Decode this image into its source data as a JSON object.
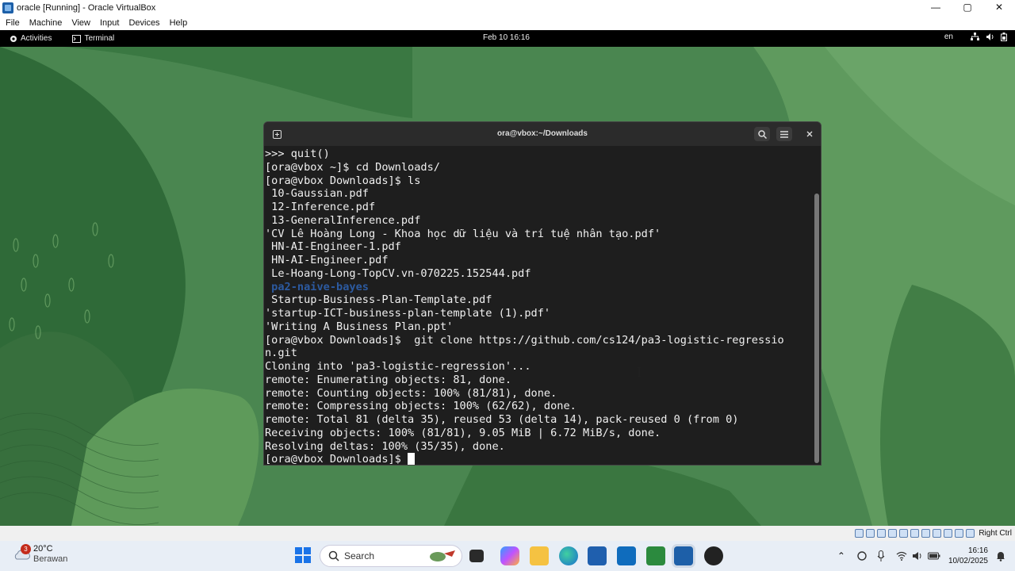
{
  "host_window": {
    "title": "oracle [Running] - Oracle VirtualBox",
    "controls": {
      "minimize": "—",
      "maximize": "▢",
      "close": "✕"
    },
    "menu": [
      "File",
      "Machine",
      "View",
      "Input",
      "Devices",
      "Help"
    ]
  },
  "gnome_bar": {
    "activities": "Activities",
    "app_label": "Terminal",
    "clock": "Feb 10  16:16",
    "lang": "en"
  },
  "terminal": {
    "title": "ora@vbox:~/Downloads",
    "lines": [
      {
        "text": ">>> quit()"
      },
      {
        "text": "[ora@vbox ~]$ cd Downloads/"
      },
      {
        "text": "[ora@vbox Downloads]$ ls"
      },
      {
        "text": " 10-Gaussian.pdf"
      },
      {
        "text": " 12-Inference.pdf"
      },
      {
        "text": " 13-GeneralInference.pdf"
      },
      {
        "text": "'CV Lê Hoàng Long - Khoa học dữ liệu và trí tuệ nhân tạo.pdf'"
      },
      {
        "text": " HN-AI-Engineer-1.pdf"
      },
      {
        "text": " HN-AI-Engineer.pdf"
      },
      {
        "text": " Le-Hoang-Long-TopCV.vn-070225.152544.pdf"
      },
      {
        "text": " pa2-naive-bayes",
        "dir": true
      },
      {
        "text": " Startup-Business-Plan-Template.pdf"
      },
      {
        "text": "'startup-ICT-business-plan-template (1).pdf'"
      },
      {
        "text": "'Writing A Business Plan.ppt'"
      },
      {
        "text": "[ora@vbox Downloads]$  git clone https://github.com/cs124/pa3-logistic-regressio"
      },
      {
        "text": "n.git"
      },
      {
        "text": "Cloning into 'pa3-logistic-regression'..."
      },
      {
        "text": "remote: Enumerating objects: 81, done."
      },
      {
        "text": "remote: Counting objects: 100% (81/81), done."
      },
      {
        "text": "remote: Compressing objects: 100% (62/62), done."
      },
      {
        "text": "remote: Total 81 (delta 35), reused 53 (delta 14), pack-reused 0 (from 0)"
      },
      {
        "text": "Receiving objects: 100% (81/81), 9.05 MiB | 6.72 MiB/s, done."
      },
      {
        "text": "Resolving deltas: 100% (35/35), done."
      }
    ],
    "prompt": "[ora@vbox Downloads]$ "
  },
  "host_status": {
    "right_ctrl": "Right Ctrl"
  },
  "taskbar": {
    "weather_temp": "20°C",
    "weather_desc": "Berawan",
    "notification_count": "3",
    "search_placeholder": "Search",
    "time": "16:16",
    "date": "10/02/2025"
  },
  "colors": {
    "dir_blue": "#2c5aa0",
    "terminal_bg": "#1e1e1e",
    "wallpaper": "#3f7a44"
  }
}
